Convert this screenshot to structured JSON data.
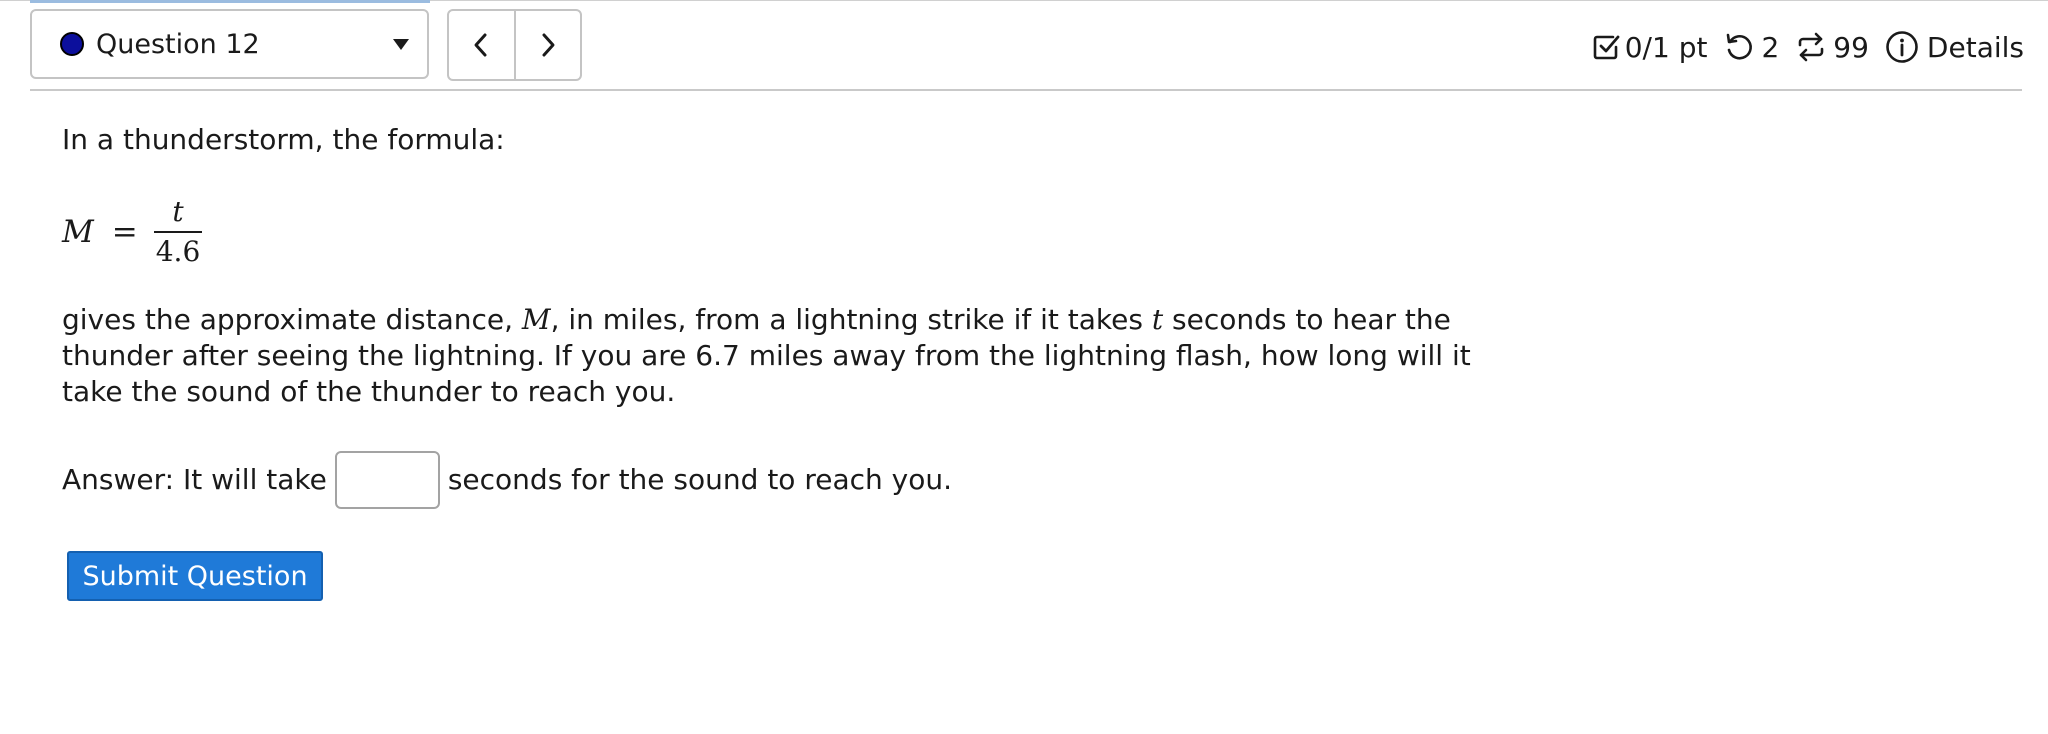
{
  "header": {
    "question_label": "Question 12",
    "question_status_color": "#0c0f9c",
    "prev_icon": "chevron-left-icon",
    "next_icon": "chevron-right-icon",
    "score": "0/1 pt",
    "retries": "2",
    "attempts": "99",
    "details_label": "Details"
  },
  "question": {
    "intro": "In a thunderstorm, the formula:",
    "formula": {
      "lhs": "M",
      "eq": "=",
      "numerator": "t",
      "denominator": "4.6"
    },
    "desc_1": "gives the approximate distance, ",
    "desc_var_m": "M",
    "desc_2": ", in miles, from a lightning strike if it takes ",
    "desc_var_t": "t",
    "desc_3": " seconds to hear the thunder after seeing the lightning. If you are 6.7 miles away from the lightning flash, how long will it take the sound of the thunder to reach you.",
    "answer_prefix": "Answer: It will take",
    "answer_value": "",
    "answer_suffix": "seconds for the sound to reach you."
  },
  "submit_label": "Submit Question",
  "colors": {
    "accent": "#1f7ad8"
  }
}
